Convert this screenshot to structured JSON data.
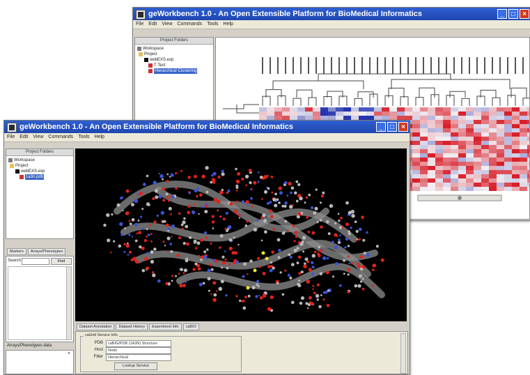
{
  "back_window": {
    "title": "geWorkbench 1.0 - An Open Extensible Platform for BioMedical Informatics",
    "menu": [
      "File",
      "Edit",
      "View",
      "Commands",
      "Tools",
      "Help"
    ],
    "project_panel": {
      "header": "Project Folders",
      "tree": [
        {
          "label": "Workspace",
          "icon": "workspace-icon"
        },
        {
          "label": "Project",
          "icon": "folder-icon"
        },
        {
          "label": "webEXS.exp",
          "icon": "dataset-icon"
        },
        {
          "label": "T-Test",
          "icon": "analysis-icon"
        },
        {
          "label": "Hierarchical Clustering",
          "icon": "analysis-icon",
          "selected": true
        }
      ]
    },
    "heatmap_colors": {
      "high": "#d8202a",
      "low": "#2534b0",
      "mid": "#f2eef2"
    }
  },
  "front_window": {
    "title": "geWorkbench 1.0 - An Open Extensible Platform for BioMedical Informatics",
    "menu": [
      "File",
      "Edit",
      "View",
      "Commands",
      "Tools",
      "Help"
    ],
    "project_panel": {
      "header": "Project Folders",
      "tree": [
        {
          "label": "Workspace",
          "icon": "workspace-icon"
        },
        {
          "label": "Project",
          "icon": "folder-icon"
        },
        {
          "label": "webEXS.exp",
          "icon": "dataset-icon"
        },
        {
          "label": "1a3n.pdb",
          "icon": "structure-icon",
          "selected": true
        }
      ]
    },
    "left_tabs": [
      "Markers",
      "Arrays/Phenotypes"
    ],
    "search_label": "Search",
    "search_button": "Find",
    "phenotype_panel_label": "Arrays/Phenotypes data",
    "bottom_tabs": [
      "Dataset Annotation",
      "Dataset History",
      "Experiment Info",
      "caBIO"
    ],
    "service_box": {
      "title": "caGrid Service Info",
      "fields": [
        {
          "label": "PDB",
          "value": "caBIG/PDB (1A3N) Structure"
        },
        {
          "label": "Host",
          "value": "Node"
        },
        {
          "label": "Filter",
          "value": "Hierarchical"
        }
      ],
      "button": "Lookup Service"
    },
    "viewer_colors": {
      "background": "#000000",
      "oxygen": "#e0231b",
      "nitrogen": "#3a55d6",
      "carbon": "#b9b9b9",
      "sulfur": "#f0e52a"
    }
  }
}
